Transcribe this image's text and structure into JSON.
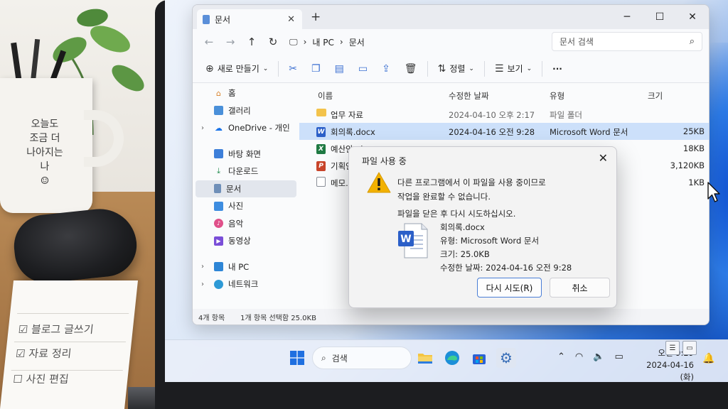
{
  "scene": {
    "mug_text": [
      "오늘도",
      "조금 더",
      "나아지는",
      "나",
      "☺"
    ],
    "notebook_items": [
      "☑ 블로그 글쓰기",
      "☑ 자료 정리",
      "☐ 사진 편집"
    ]
  },
  "explorer": {
    "tab_title": "문서",
    "address": [
      "내 PC",
      "문서"
    ],
    "search_placeholder": "문서 검색",
    "toolbar": {
      "new_label": "새로 만들기",
      "sort_label": "정렬",
      "view_label": "보기",
      "more_label": "···"
    },
    "nav": [
      {
        "label": "홈",
        "icon": "home-icon"
      },
      {
        "label": "갤러리",
        "icon": "gallery-icon"
      },
      {
        "label": "OneDrive - 개인",
        "icon": "cloud-icon"
      },
      {
        "label": "바탕 화면",
        "icon": "desktop-icon"
      },
      {
        "label": "다운로드",
        "icon": "download-icon"
      },
      {
        "label": "문서",
        "icon": "document-icon"
      },
      {
        "label": "사진",
        "icon": "photo-icon"
      },
      {
        "label": "음악",
        "icon": "music-icon"
      },
      {
        "label": "동영상",
        "icon": "video-icon"
      },
      {
        "label": "내 PC",
        "icon": "pc-icon"
      },
      {
        "label": "네트워크",
        "icon": "network-icon"
      }
    ],
    "columns": [
      "이름",
      "수정한 날짜",
      "유형",
      "크기"
    ],
    "files": [
      {
        "name": "업무 자료",
        "date": "2024-04-10 오후 2:17",
        "type": "파일 폴더",
        "size": "",
        "icon": "folder-icon"
      },
      {
        "name": "회의록.docx",
        "date": "2024-04-16 오전 9:28",
        "type": "Microsoft Word 문서",
        "size": "25KB",
        "icon": "word-icon"
      },
      {
        "name": "예산안.xlsx",
        "date": "",
        "type": "",
        "size": "18KB",
        "icon": "excel-icon"
      },
      {
        "name": "기획안.pptx",
        "date": "",
        "type": "",
        "size": "3,120KB",
        "icon": "powerpoint-icon"
      },
      {
        "name": "메모.txt",
        "date": "",
        "type": "",
        "size": "1KB",
        "icon": "text-file-icon"
      }
    ],
    "status": {
      "count": "4개 항목",
      "selection": "1개 항목 선택함 25.0KB"
    }
  },
  "dialog": {
    "title": "파일 사용 중",
    "message_line1": "다른 프로그램에서 이 파일을 사용 중이므로",
    "message_line2": "작업을 완료할 수 없습니다.",
    "hint": "파일을 닫은 후 다시 시도하십시오.",
    "file_name": "회의록.docx",
    "file_type": "유형: Microsoft Word 문서",
    "file_size": "크기: 25.0KB",
    "file_modified": "수정한 날짜: 2024-04-16 오전 9:28",
    "retry_label": "다시 시도(R)",
    "cancel_label": "취소"
  },
  "taskbar": {
    "search_label": "검색",
    "time": "오전 9:29",
    "date": "2024-04-16 (화)"
  },
  "colors": {
    "accent": "#2b6fd6",
    "selection": "#cce0fa",
    "warning": "#f2b100",
    "word": "#2b5fc8",
    "excel": "#1f7a43",
    "powerpoint": "#c8442a"
  }
}
